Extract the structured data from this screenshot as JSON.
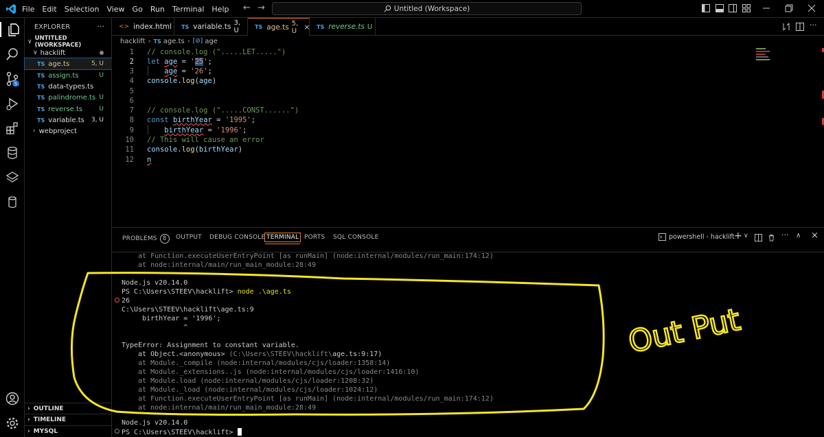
{
  "menu": {
    "items": [
      "File",
      "Edit",
      "Selection",
      "View",
      "Go",
      "Run",
      "Terminal",
      "Help"
    ]
  },
  "command_center": {
    "text": "Untitled (Workspace)"
  },
  "sidebar": {
    "title": "EXPLORER",
    "workspace": "UNTITLED (WORKSPACE)",
    "folder": "hacklift",
    "files": [
      {
        "name": "age.ts",
        "badge": "5, U"
      },
      {
        "name": "assign.ts",
        "badge": "U"
      },
      {
        "name": "data-types.ts",
        "badge": ""
      },
      {
        "name": "palindrome.ts",
        "badge": "U"
      },
      {
        "name": "reverse.ts",
        "badge": "U"
      },
      {
        "name": "variable.ts",
        "badge": "3, U"
      }
    ],
    "other_folder": "webproject",
    "sections": [
      "OUTLINE",
      "TIMELINE",
      "MYSQL"
    ]
  },
  "tabs": [
    {
      "name": "index.html",
      "badge": ""
    },
    {
      "name": "variable.ts",
      "badge": "3, U"
    },
    {
      "name": "age.ts",
      "badge": "5, U"
    },
    {
      "name": "reverse.ts",
      "badge": "U"
    }
  ],
  "breadcrumb": {
    "folder": "hacklift",
    "file": "age.ts",
    "symbol": "age"
  },
  "editor": {
    "line_numbers": [
      "1",
      "2",
      "3",
      "4",
      "5",
      "6",
      "7",
      "8",
      "9",
      "10",
      "11",
      "12"
    ]
  },
  "panel": {
    "tabs": [
      "PROBLEMS",
      "OUTPUT",
      "DEBUG CONSOLE",
      "TERMINAL",
      "PORTS",
      "SQL CONSOLE"
    ],
    "problems_count": "8",
    "terminal_name": "powershell - hacklift",
    "terminal_lines": [
      "    at Function.executeUserEntryPoint [as runMain] (node:internal/modules/run_main:174:12)",
      "    at node:internal/main/run_main_module:28:49",
      "",
      "Node.js v20.14.0",
      "PS C:\\Users\\STEEV\\hacklift> ",
      "26",
      "C:\\Users\\STEEV\\hacklift\\age.ts:9",
      "     birthYear = '1996';",
      "               ^",
      "",
      "TypeError: Assignment to constant variable.",
      "    at Object.<anonymous> ",
      "    at Module._compile (node:internal/modules/cjs/loader:1358:14)",
      "    at Module._extensions..js (node:internal/modules/cjs/loader:1416:10)",
      "    at Module.load (node:internal/modules/cjs/loader:1208:32)",
      "    at Module._load (node:internal/modules/cjs/loader:1024:12)",
      "    at Function.executeUserEntryPoint [as runMain] (node:internal/modules/run_main:174:12)",
      "    at node:internal/main/run_main_module:28:49",
      "",
      "Node.js v20.14.0",
      "PS C:\\Users\\STEEV\\hacklift> "
    ],
    "command": "node .\\age.ts",
    "anon_path": "(C:\\Users\\STEEV\\hacklift\\",
    "anon_file": "age.ts:9:17)"
  },
  "annotation": {
    "text": "Out Put"
  },
  "colors": {
    "accent": "#e47b2f",
    "annotation": "#f5e625",
    "error": "#f14c4c",
    "untracked": "#73c991"
  }
}
